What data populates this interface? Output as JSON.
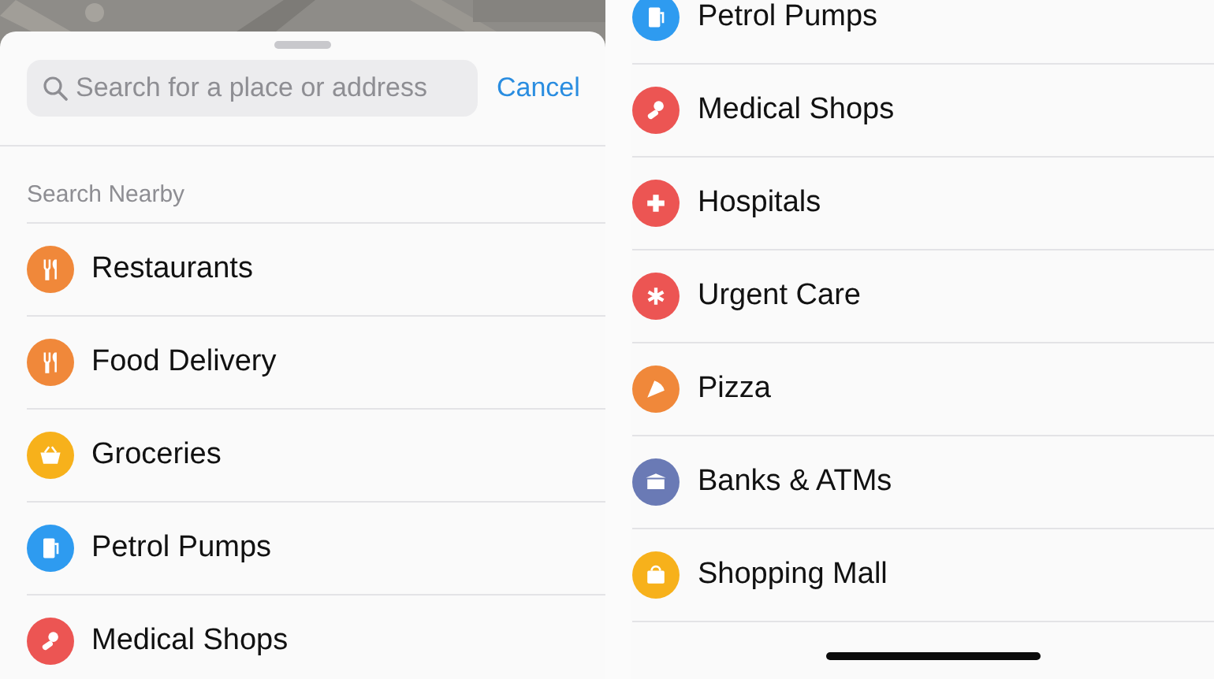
{
  "left_screen": {
    "search": {
      "placeholder": "Search for a place or address"
    },
    "cancel": "Cancel",
    "section_title": "Search Nearby",
    "items": [
      {
        "label": "Restaurants",
        "kind": "fork",
        "color": "#f0883a"
      },
      {
        "label": "Food Delivery",
        "kind": "fork",
        "color": "#f0883a"
      },
      {
        "label": "Groceries",
        "kind": "basket",
        "color": "#f7b11b"
      },
      {
        "label": "Petrol Pumps",
        "kind": "pump",
        "color": "#2e9bf0"
      },
      {
        "label": "Medical Shops",
        "kind": "pill",
        "color": "#ec5553"
      }
    ]
  },
  "right_screen": {
    "items": [
      {
        "label": "Petrol Pumps",
        "kind": "pump",
        "color": "#2e9bf0"
      },
      {
        "label": "Medical Shops",
        "kind": "pill",
        "color": "#ec5553"
      },
      {
        "label": "Hospitals",
        "kind": "cross",
        "color": "#ec5553"
      },
      {
        "label": "Urgent Care",
        "kind": "asterisk",
        "color": "#ec5553"
      },
      {
        "label": "Pizza",
        "kind": "pizza",
        "color": "#f0883a"
      },
      {
        "label": "Banks & ATMs",
        "kind": "bank",
        "color": "#6a7ab5"
      },
      {
        "label": "Shopping Mall",
        "kind": "bag",
        "color": "#f7b11b"
      }
    ]
  }
}
